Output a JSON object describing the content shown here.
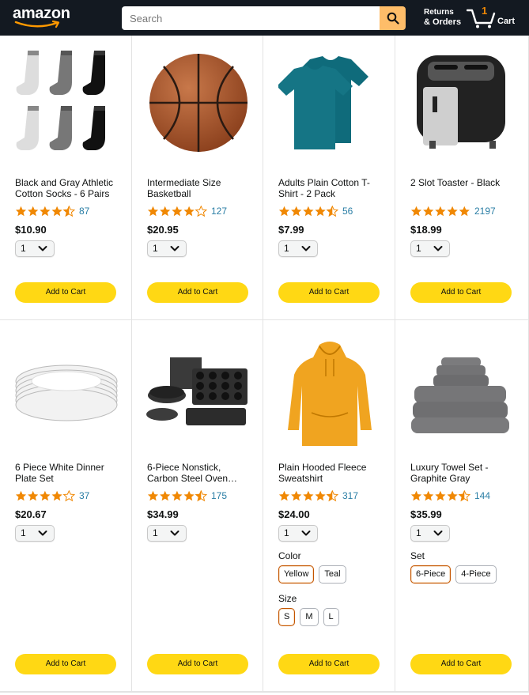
{
  "header": {
    "logo": "amazon",
    "search_placeholder": "Search",
    "returns_line1": "Returns",
    "returns_line2": "& Orders",
    "cart_count": "1",
    "cart_label": "Cart"
  },
  "colors": {
    "header_bg": "#131921",
    "search_btn": "#febd69",
    "star": "#f08804",
    "link": "#2a7ea5",
    "add_btn": "#ffd814"
  },
  "add_label": "Add to Cart",
  "products": [
    {
      "title": "Black and Gray Athletic Cotton Socks - 6 Pairs",
      "rating": 4.5,
      "reviews": "87",
      "price": "$10.90",
      "qty": "1",
      "image": "socks"
    },
    {
      "title": "Intermediate Size Basketball",
      "rating": 4.0,
      "reviews": "127",
      "price": "$20.95",
      "qty": "1",
      "image": "basketball"
    },
    {
      "title": "Adults Plain Cotton T-Shirt - 2 Pack",
      "rating": 4.5,
      "reviews": "56",
      "price": "$7.99",
      "qty": "1",
      "image": "tshirt"
    },
    {
      "title": "2 Slot Toaster - Black",
      "rating": 5.0,
      "reviews": "2197",
      "price": "$18.99",
      "qty": "1",
      "image": "toaster"
    },
    {
      "title": "6 Piece White Dinner Plate Set",
      "rating": 4.0,
      "reviews": "37",
      "price": "$20.67",
      "qty": "1",
      "image": "plates"
    },
    {
      "title": "6-Piece Nonstick, Carbon Steel Oven…",
      "rating": 4.5,
      "reviews": "175",
      "price": "$34.99",
      "qty": "1",
      "image": "bakeware"
    },
    {
      "title": "Plain Hooded Fleece Sweatshirt",
      "rating": 4.5,
      "reviews": "317",
      "price": "$24.00",
      "qty": "1",
      "image": "hoodie",
      "options": [
        {
          "label": "Color",
          "values": [
            "Yellow",
            "Teal"
          ],
          "selected": "Yellow"
        },
        {
          "label": "Size",
          "values": [
            "S",
            "M",
            "L"
          ],
          "selected": "S"
        }
      ]
    },
    {
      "title": "Luxury Towel Set - Graphite Gray",
      "rating": 4.5,
      "reviews": "144",
      "price": "$35.99",
      "qty": "1",
      "image": "towels",
      "options": [
        {
          "label": "Set",
          "values": [
            "6-Piece",
            "4-Piece"
          ],
          "selected": "6-Piece"
        }
      ]
    }
  ]
}
